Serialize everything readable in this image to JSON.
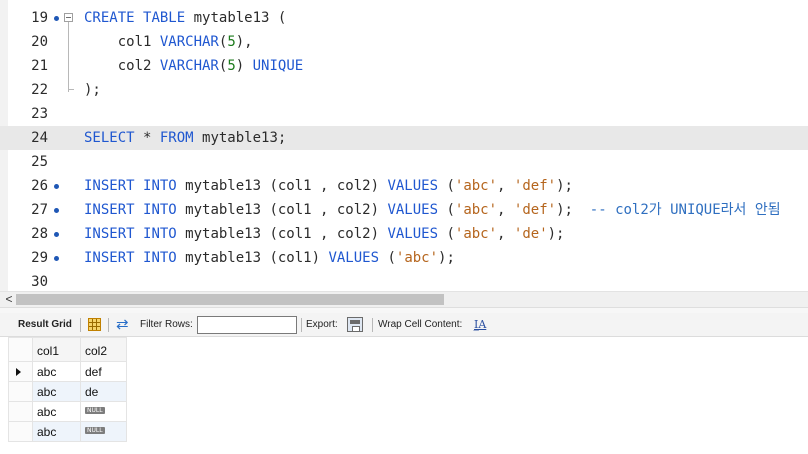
{
  "editor": {
    "lines": [
      {
        "num": "19",
        "marker": true,
        "fold": "start",
        "tokens": [
          {
            "t": "CREATE",
            "c": "kw"
          },
          {
            "t": " "
          },
          {
            "t": "TABLE",
            "c": "kw"
          },
          {
            "t": " mytable13 ("
          }
        ]
      },
      {
        "num": "20",
        "tokens": [
          {
            "t": "    col1 "
          },
          {
            "t": "VARCHAR",
            "c": "kw"
          },
          {
            "t": "("
          },
          {
            "t": "5",
            "c": "num"
          },
          {
            "t": "),"
          }
        ]
      },
      {
        "num": "21",
        "tokens": [
          {
            "t": "    col2 "
          },
          {
            "t": "VARCHAR",
            "c": "kw"
          },
          {
            "t": "("
          },
          {
            "t": "5",
            "c": "num"
          },
          {
            "t": ") "
          },
          {
            "t": "UNIQUE",
            "c": "kw"
          }
        ]
      },
      {
        "num": "22",
        "fold": "end",
        "tokens": [
          {
            "t": ");"
          }
        ]
      },
      {
        "num": "23",
        "tokens": []
      },
      {
        "num": "24",
        "marker": true,
        "current": true,
        "tokens": [
          {
            "t": "SELECT",
            "c": "kw"
          },
          {
            "t": " * "
          },
          {
            "t": "FROM",
            "c": "kw"
          },
          {
            "t": " mytable13;"
          }
        ]
      },
      {
        "num": "25",
        "tokens": []
      },
      {
        "num": "26",
        "marker": true,
        "tokens": [
          {
            "t": "INSERT",
            "c": "kw"
          },
          {
            "t": " "
          },
          {
            "t": "INTO",
            "c": "kw"
          },
          {
            "t": " mytable13 (col1 , col2) "
          },
          {
            "t": "VALUES",
            "c": "kw"
          },
          {
            "t": " ("
          },
          {
            "t": "'abc'",
            "c": "str"
          },
          {
            "t": ", "
          },
          {
            "t": "'def'",
            "c": "str"
          },
          {
            "t": ");"
          }
        ]
      },
      {
        "num": "27",
        "marker": true,
        "tokens": [
          {
            "t": "INSERT",
            "c": "kw"
          },
          {
            "t": " "
          },
          {
            "t": "INTO",
            "c": "kw"
          },
          {
            "t": " mytable13 (col1 , col2) "
          },
          {
            "t": "VALUES",
            "c": "kw"
          },
          {
            "t": " ("
          },
          {
            "t": "'abc'",
            "c": "str"
          },
          {
            "t": ", "
          },
          {
            "t": "'def'",
            "c": "str"
          },
          {
            "t": ");  "
          },
          {
            "t": "-- col2가 UNIQUE라서 안됨",
            "c": "cmt"
          }
        ]
      },
      {
        "num": "28",
        "marker": true,
        "tokens": [
          {
            "t": "INSERT",
            "c": "kw"
          },
          {
            "t": " "
          },
          {
            "t": "INTO",
            "c": "kw"
          },
          {
            "t": " mytable13 (col1 , col2) "
          },
          {
            "t": "VALUES",
            "c": "kw"
          },
          {
            "t": " ("
          },
          {
            "t": "'abc'",
            "c": "str"
          },
          {
            "t": ", "
          },
          {
            "t": "'de'",
            "c": "str"
          },
          {
            "t": ");"
          }
        ]
      },
      {
        "num": "29",
        "marker": true,
        "tokens": [
          {
            "t": "INSERT",
            "c": "kw"
          },
          {
            "t": " "
          },
          {
            "t": "INTO",
            "c": "kw"
          },
          {
            "t": " mytable13 (col1) "
          },
          {
            "t": "VALUES",
            "c": "kw"
          },
          {
            "t": " ("
          },
          {
            "t": "'abc'",
            "c": "str"
          },
          {
            "t": ");"
          }
        ]
      },
      {
        "num": "30",
        "tokens": []
      }
    ]
  },
  "scrollbar": {
    "left_arrow": "<"
  },
  "toolbar": {
    "result_grid_label": "Result Grid",
    "filter_rows_label": "Filter Rows:",
    "filter_value": "",
    "export_label": "Export:",
    "wrap_cell_label": "Wrap Cell Content:",
    "wrap_icon_glyph": "I̲A"
  },
  "grid": {
    "columns": [
      "col1",
      "col2"
    ],
    "null_label": "NULL",
    "rows": [
      {
        "col1": "abc",
        "col2": "def",
        "col2_null": false,
        "selected": true
      },
      {
        "col1": "abc",
        "col2": "de",
        "col2_null": false,
        "selected": false
      },
      {
        "col1": "abc",
        "col2": null,
        "col2_null": true,
        "selected": false
      },
      {
        "col1": "abc",
        "col2": null,
        "col2_null": true,
        "selected": false
      }
    ]
  },
  "colors": {
    "keyword": "#1f57d0",
    "string": "#b5651d",
    "number": "#1b7a1b",
    "comment": "#2f6fc0",
    "current_line": "#e8e8e8",
    "alt_row": "#eef4fb"
  }
}
